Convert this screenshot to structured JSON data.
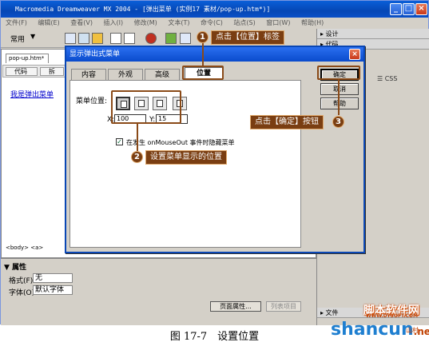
{
  "app": {
    "title": "Macromedia Dreamweaver MX 2004 - [弹出菜单 (实例17 素材/pop-up.htm*)]",
    "window_controls": [
      "_",
      "□",
      "×"
    ],
    "menu": [
      "文件(F)",
      "编辑(E)",
      "查看(V)",
      "插入(I)",
      "修改(M)",
      "文本(T)",
      "命令(C)",
      "站点(S)",
      "窗口(W)",
      "帮助(H)"
    ],
    "toolbar_category": "常用"
  },
  "right_panel": {
    "design": "▸ 设计",
    "code": "▸ 代码",
    "tag_inspector": "☰ CSS",
    "files": "▸ 文件"
  },
  "document": {
    "tab": "pop-up.htm*",
    "code_button": "代码",
    "split_button": "拆",
    "link_text": "我是弹出菜单",
    "tag_selector": "<body> <a>"
  },
  "properties": {
    "title": "▼ 属性",
    "format_label": "格式(F)",
    "format_value": "无",
    "font_label": "字体(O)",
    "font_value": "默认字体",
    "page_props_button": "页面属性...",
    "list_item_button": "列表项目"
  },
  "dialog": {
    "title": "显示弹出式菜单",
    "close": "×",
    "tabs": [
      "内容",
      "外观",
      "高级",
      "位置"
    ],
    "active_tab": 3,
    "menu_position_label": "菜单位置:",
    "x_label": "X:",
    "x_value": "100",
    "y_label": "Y:",
    "y_value": "15",
    "hide_checkbox_label": "在发生 onMouseOut 事件时隐藏菜单",
    "hide_checked": true,
    "buttons": {
      "ok": "确定",
      "cancel": "取消",
      "help": "帮助"
    }
  },
  "annotations": {
    "step1_number": "1",
    "step1_text": "点击【位置】标签",
    "step2_number": "2",
    "step2_text": "设置菜单显示的位置",
    "step3_number": "3",
    "step3_text": "点击【确定】按钮"
  },
  "caption": "图 17-7　设置位置",
  "watermark": {
    "brand": "脚本软件网",
    "site": "shancun",
    "url": "WWW.DYSOFT.COM",
    "suffix": ".net",
    "cn": "山村"
  },
  "colors": {
    "titlebar": "#0a4fc7",
    "annotation": "#7a3e12",
    "link": "#0000cc"
  }
}
